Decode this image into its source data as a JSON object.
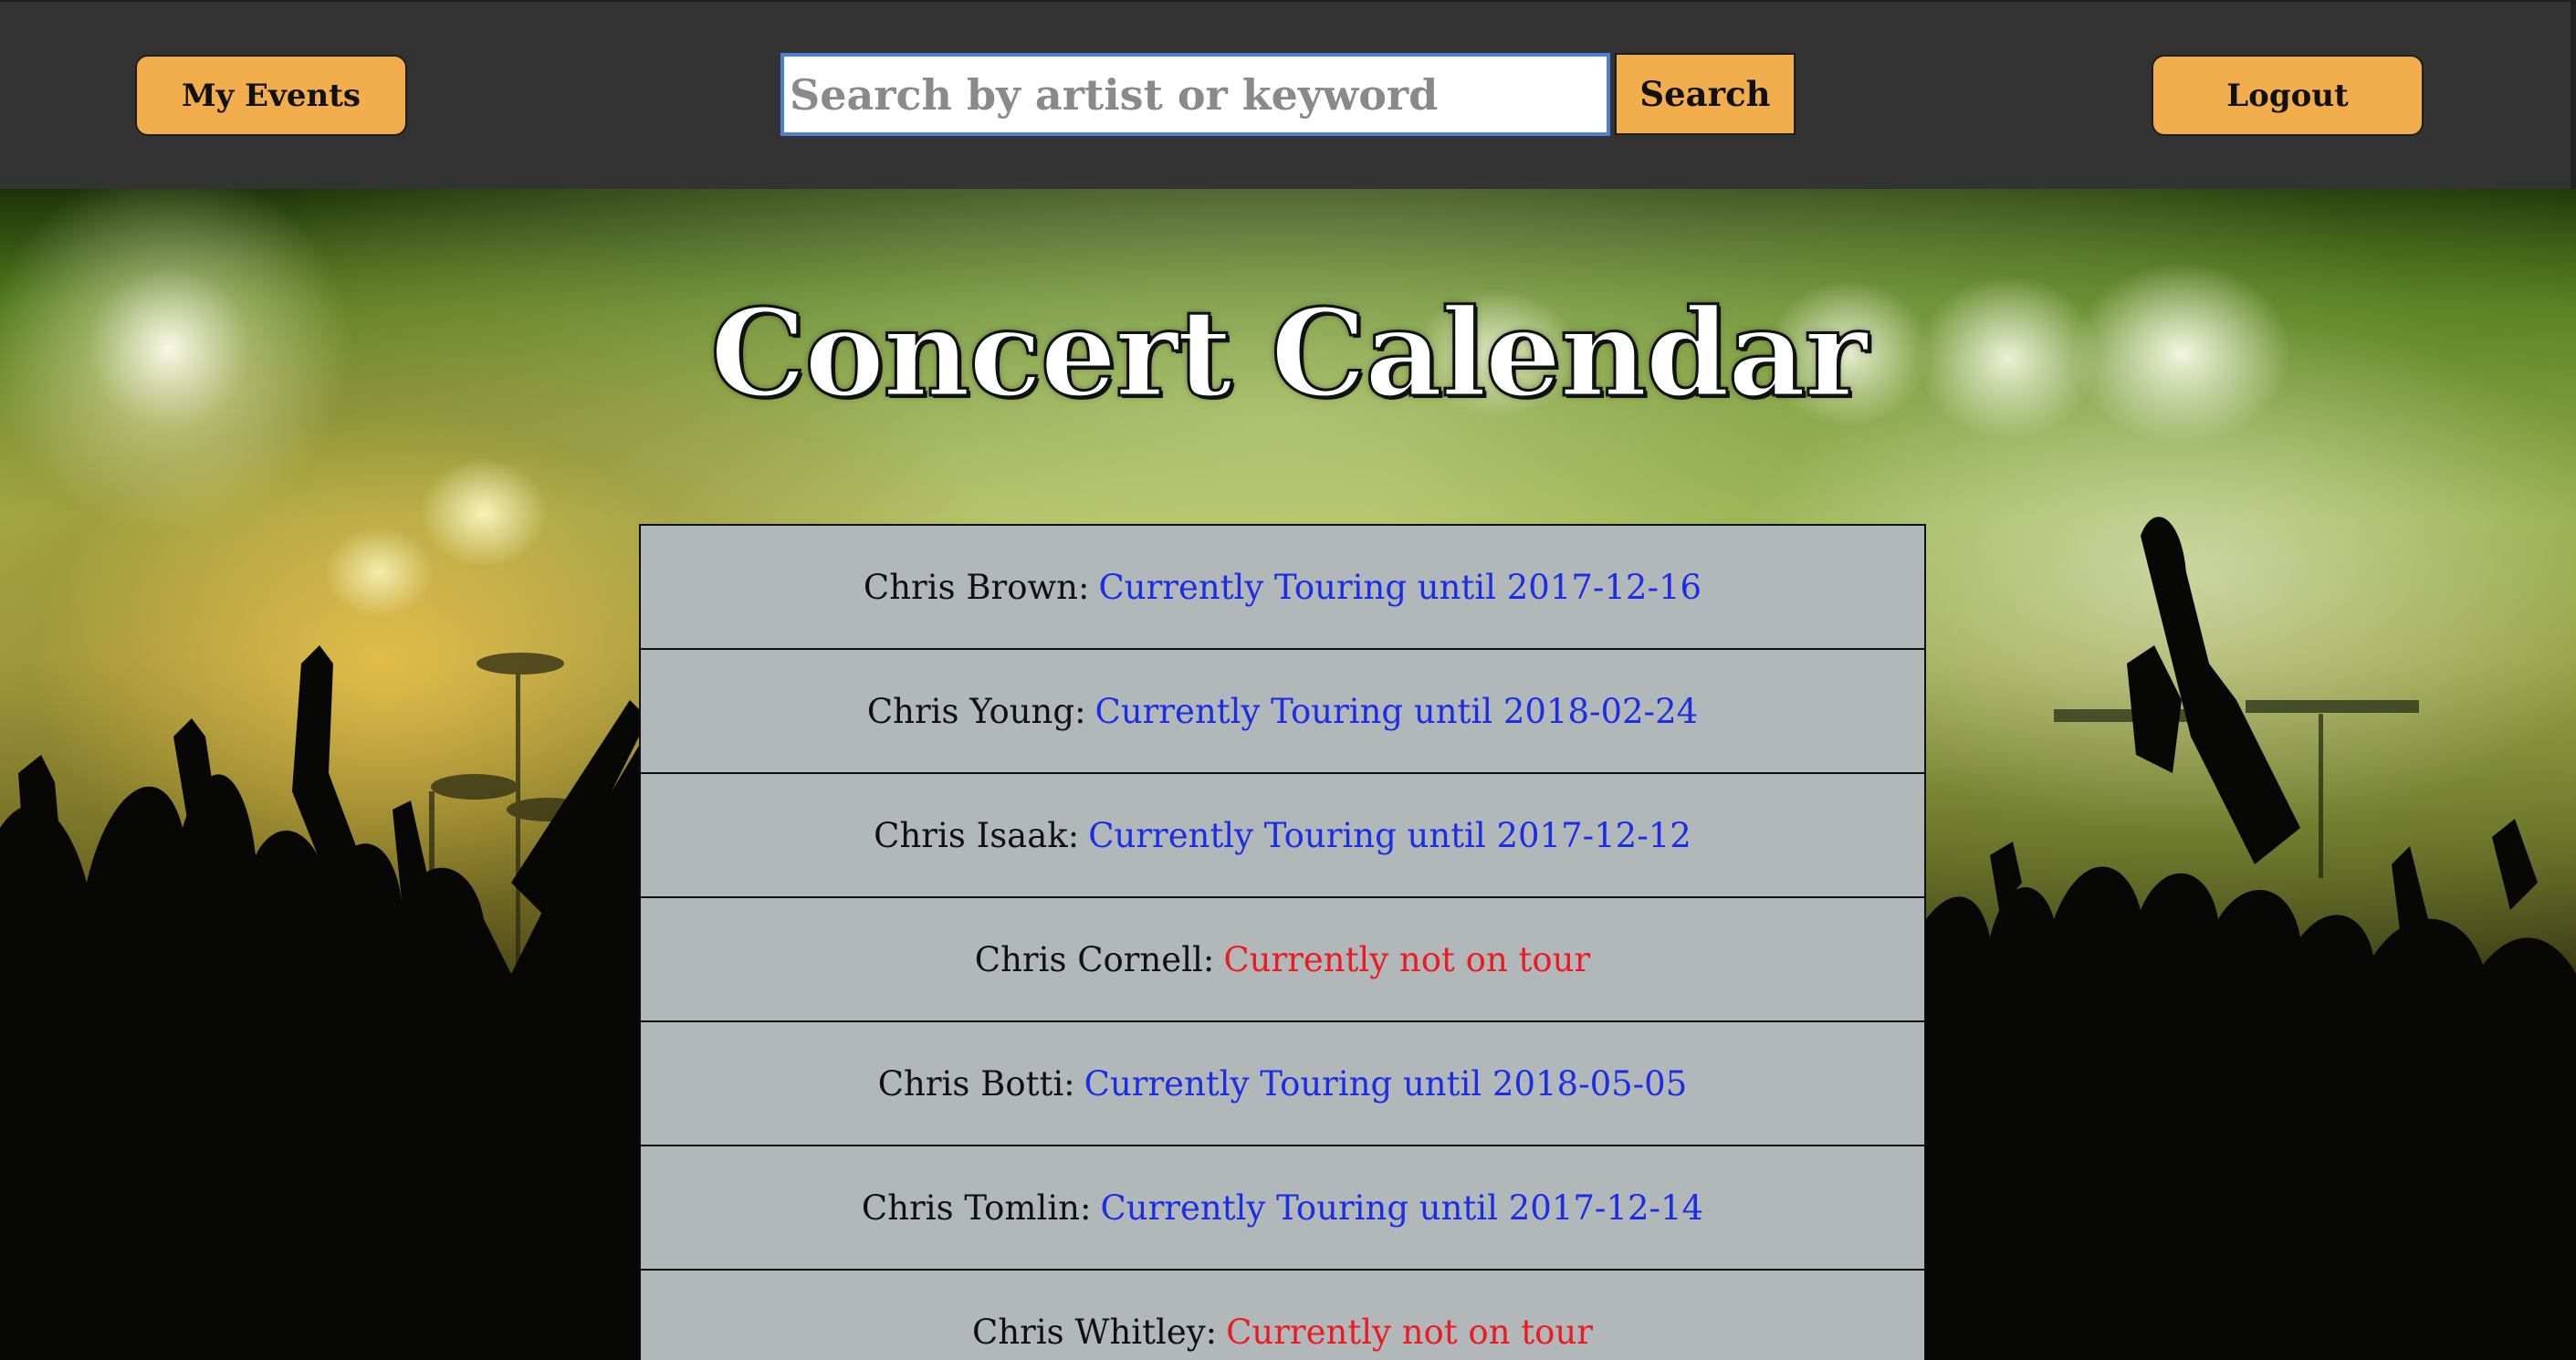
{
  "navbar": {
    "my_events_label": "My Events",
    "search_placeholder": "Search by artist or keyword",
    "search_value": "",
    "search_button_label": "Search",
    "logout_label": "Logout"
  },
  "page_title": "Concert Calendar",
  "artists": [
    {
      "name": "Chris Brown:",
      "status": "Currently Touring until 2017-12-16",
      "touring": true
    },
    {
      "name": "Chris Young:",
      "status": "Currently Touring until 2018-02-24",
      "touring": true
    },
    {
      "name": "Chris Isaak:",
      "status": "Currently Touring until 2017-12-12",
      "touring": true
    },
    {
      "name": "Chris Cornell:",
      "status": "Currently not on tour",
      "touring": false
    },
    {
      "name": "Chris Botti:",
      "status": "Currently Touring until 2018-05-05",
      "touring": true
    },
    {
      "name": "Chris Tomlin:",
      "status": "Currently Touring until 2017-12-14",
      "touring": true
    },
    {
      "name": "Chris Whitley:",
      "status": "Currently not on tour",
      "touring": false
    }
  ],
  "colors": {
    "navbar_bg": "#333333",
    "button_accent": "#f2ae4c",
    "row_bg": "#b2b8ba",
    "touring_text": "#1b2de5",
    "not_touring_text": "#ea1b23"
  },
  "background_image": "concert-crowd-stage-lights"
}
